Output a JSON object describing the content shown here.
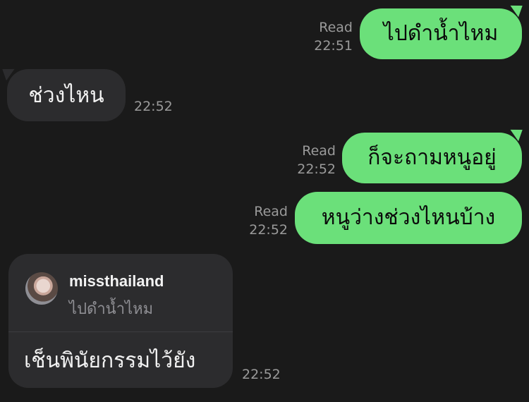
{
  "messages": [
    {
      "direction": "out",
      "text": "ไปดำน้ำไหม",
      "read": "Read",
      "time": "22:51"
    },
    {
      "direction": "in",
      "text": "ช่วงไหน",
      "time": "22:52"
    },
    {
      "direction": "out",
      "text": "ก็จะถามหนูอยู่",
      "read": "Read",
      "time": "22:52"
    },
    {
      "direction": "out",
      "text": "หนูว่างช่วงไหนบ้าง",
      "read": "Read",
      "time": "22:52"
    },
    {
      "direction": "in",
      "reply_to": {
        "username": "missthailand",
        "text": "ไปดำน้ำไหม"
      },
      "text": "เช็นพินัยกรรมไว้ยัง",
      "time": "22:52"
    }
  ],
  "colors": {
    "background": "#1a1a1a",
    "outgoing_bubble": "#6be07a",
    "incoming_bubble": "#2c2c2e",
    "meta_text": "#9a9a9a"
  }
}
